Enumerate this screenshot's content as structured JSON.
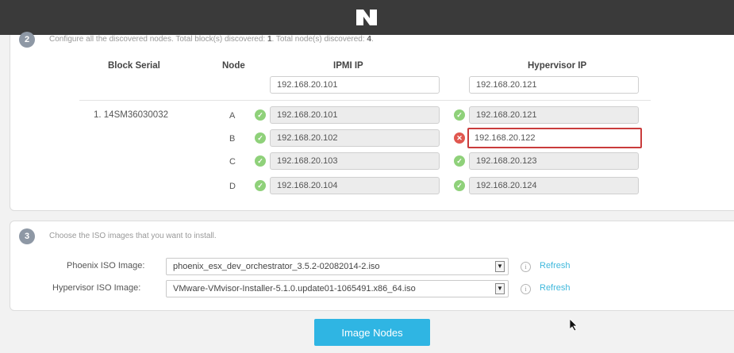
{
  "header": {
    "logo_icon": "nutanix-logo"
  },
  "step2": {
    "number": "2",
    "text_prefix": "Configure all the discovered nodes. Total block(s) discovered: ",
    "blocks": "1",
    "text_mid": ". Total node(s) discovered: ",
    "nodes": "4",
    "text_end": "."
  },
  "table": {
    "headers": {
      "block_serial": "Block Serial",
      "node": "Node",
      "ipmi_ip": "IPMI IP",
      "hypervisor_ip": "Hypervisor IP"
    },
    "template": {
      "ipmi_ip": "192.168.20.101",
      "hypervisor_ip": "192.168.20.121"
    },
    "block": {
      "serial": "1.  14SM36030032"
    },
    "rows": [
      {
        "node": "A",
        "ipmi_ip": "192.168.20.101",
        "ipmi_status": "ok",
        "hypervisor_ip": "192.168.20.121",
        "hypervisor_status": "ok"
      },
      {
        "node": "B",
        "ipmi_ip": "192.168.20.102",
        "ipmi_status": "ok",
        "hypervisor_ip": "192.168.20.122",
        "hypervisor_status": "error"
      },
      {
        "node": "C",
        "ipmi_ip": "192.168.20.103",
        "ipmi_status": "ok",
        "hypervisor_ip": "192.168.20.123",
        "hypervisor_status": "ok"
      },
      {
        "node": "D",
        "ipmi_ip": "192.168.20.104",
        "ipmi_status": "ok",
        "hypervisor_ip": "192.168.20.124",
        "hypervisor_status": "ok"
      }
    ]
  },
  "step3": {
    "number": "3",
    "text": "Choose the ISO images that you want to install.",
    "phoenix": {
      "label": "Phoenix ISO Image:",
      "value": "phoenix_esx_dev_orchestrator_3.5.2-02082014-2.iso",
      "refresh": "Refresh"
    },
    "hypervisor": {
      "label": "Hypervisor ISO Image:",
      "value": "VMware-VMvisor-Installer-5.1.0.update01-1065491.x86_64.iso",
      "refresh": "Refresh"
    }
  },
  "actions": {
    "image_nodes": "Image Nodes"
  },
  "colors": {
    "accent": "#2fb5e3",
    "ok": "#8fd17a",
    "error": "#e0574f",
    "error_border": "#c93c3c",
    "header_bg": "#3a3a3a"
  }
}
